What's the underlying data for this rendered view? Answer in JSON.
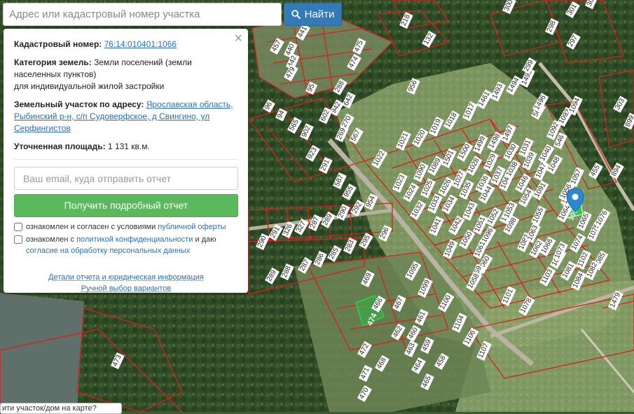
{
  "search": {
    "placeholder": "Адрес или кадастровый номер участка",
    "button_label": "Найти"
  },
  "panel": {
    "cadastral_label": "Кадастровый номер:",
    "cadastral_value": "76:14:010401:1066",
    "category_label": "Категория земель:",
    "category_value": "Земли поселений (земли населенных пунктов)",
    "category_use": "для индивидуальной жилой застройки",
    "address_label": "Земельный участок по адресу:",
    "address_value": "Ярославская область, Рыбинский р-н, с/п Судоверфское, д Свингино, ул Серфингистов",
    "area_label": "Уточненная площадь:",
    "area_value": "1 131 кв.м.",
    "email_placeholder": "Ваш email, куда отправить отчет",
    "get_report_label": "Получить подробный отчет",
    "check1_text": "ознакомлен и согласен с условиями",
    "check1_link": "публичной оферты",
    "check2_text_a": "ознакомлен с",
    "check2_link_a": "политикой конфиденциальности",
    "check2_text_b": "и даю",
    "check2_link_b": "согласие на обработку персональных данных",
    "details_link": "Детали отчета и юридическая информация",
    "manual_link": "Ручной выбор вариантов",
    "close_symbol": "×"
  },
  "bottom_tip": "ити участок/дом на карте?",
  "map": {
    "parcel_labels": [
      "218",
      "132",
      "956",
      "565",
      "546",
      "455",
      "1479",
      "1078",
      "1101",
      "1103",
      "1102",
      "1085",
      "1084",
      "1081",
      "1082",
      "1080",
      "1083",
      "1062",
      "1063",
      "1064",
      "1065",
      "1066",
      "1073",
      "1074",
      "1075",
      "1076",
      "1105",
      "1098",
      "1097",
      "1096",
      "1061",
      "1060",
      "1059",
      "1058",
      "1057",
      "1056",
      "1055",
      "1054",
      "1053",
      "1052",
      "1051",
      "1050",
      "1049",
      "1048",
      "1047",
      "1046",
      "1045",
      "1044",
      "1043",
      "1042",
      "1041",
      "1040",
      "1039",
      "1038",
      "1037",
      "1036",
      "1035",
      "1034",
      "1033",
      "1032",
      "1031",
      "1030",
      "1029",
      "1028",
      "1027",
      "1026",
      "1025",
      "1024",
      "1023",
      "1022",
      "1021",
      "1020",
      "1019",
      "1018",
      "1017",
      "1461",
      "1493",
      "1494",
      "1495",
      "1496",
      "1497",
      "1498",
      "1499",
      "1500",
      "1501",
      "1089",
      "1090",
      "1091",
      "1092",
      "1093",
      "1094",
      "1095",
      "1099",
      "1100",
      "1104",
      "1106",
      "1107",
      "458",
      "459",
      "460",
      "461",
      "462",
      "463",
      "464",
      "465",
      "466",
      "467",
      "468",
      "469",
      "470",
      "471",
      "472",
      "473",
      "474",
      "475",
      "457",
      "440",
      "441",
      "442",
      "479",
      "95",
      "96",
      "94",
      "565",
      "902",
      "923",
      "291",
      "288",
      "642",
      "942",
      "602",
      "270",
      "269",
      "567",
      "587",
      "955",
      "954",
      "292",
      "290",
      "289",
      "287",
      "327",
      "326",
      "291",
      "290",
      "289",
      "288",
      "287",
      "286",
      "285",
      "283",
      "295",
      "296",
      "297",
      "298",
      "299",
      "300",
      "301",
      "302",
      "303",
      "899",
      "894",
      "891",
      "814",
      "347",
      "339",
      "67",
      "16",
      "580"
    ],
    "highlight_label": "1066",
    "green_label": "474"
  },
  "colors": {
    "accent": "#337ab7",
    "button_green": "#5cb85c",
    "parcel_line": "#d62020",
    "pin": "#2a87d0"
  }
}
